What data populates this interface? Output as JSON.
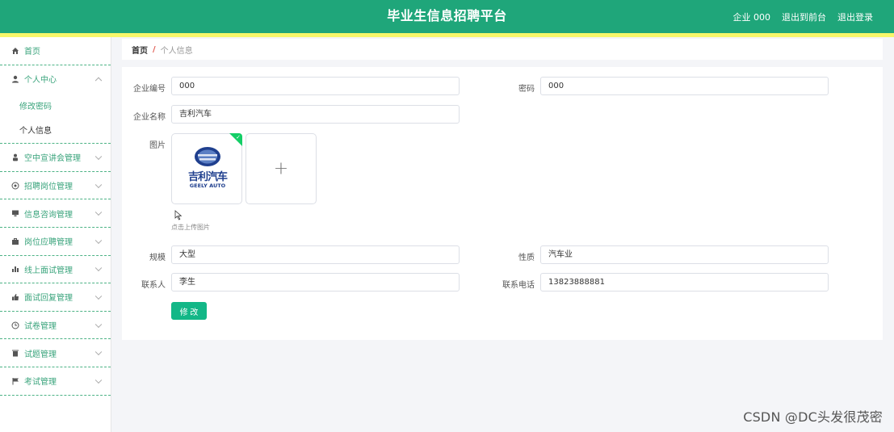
{
  "header": {
    "title": "毕业生信息招聘平台",
    "user": "企业 000",
    "back_front": "退出到前台",
    "logout": "退出登录",
    "color": "#1fa67a",
    "strip_color": "#f7f76a"
  },
  "sidebar": {
    "items": [
      {
        "label": "首页",
        "icon": "home-icon"
      },
      {
        "label": "个人中心",
        "icon": "user-icon",
        "sub": [
          "修改密码",
          "个人信息"
        ]
      },
      {
        "label": "空中宣讲会管理",
        "icon": "person-icon"
      },
      {
        "label": "招聘岗位管理",
        "icon": "target-icon"
      },
      {
        "label": "信息咨询管理",
        "icon": "monitor-icon"
      },
      {
        "label": "岗位应聘管理",
        "icon": "briefcase-icon"
      },
      {
        "label": "线上面试管理",
        "icon": "bar-chart-icon"
      },
      {
        "label": "面试回复管理",
        "icon": "thumb-icon"
      },
      {
        "label": "试卷管理",
        "icon": "clock-icon"
      },
      {
        "label": "试题管理",
        "icon": "trash-icon"
      },
      {
        "label": "考试管理",
        "icon": "flag-icon"
      }
    ]
  },
  "breadcrumb": {
    "home": "首页",
    "sep": "/",
    "current": "个人信息"
  },
  "form": {
    "company_no_label": "企业编号",
    "company_no": "000",
    "password_label": "密码",
    "password": "000",
    "company_name_label": "企业名称",
    "company_name": "吉利汽车",
    "image_label": "图片",
    "logo_cn": "吉利汽车",
    "logo_en": "GEELY AUTO",
    "upload_hint": "点击上传图片",
    "scale_label": "规模",
    "scale": "大型",
    "nature_label": "性质",
    "nature": "汽车业",
    "contact_label": "联系人",
    "contact": "李生",
    "phone_label": "联系电话",
    "phone": "13823888881",
    "submit": "修 改",
    "accent": "#13b787"
  },
  "watermark": "CSDN @DC头发很茂密"
}
